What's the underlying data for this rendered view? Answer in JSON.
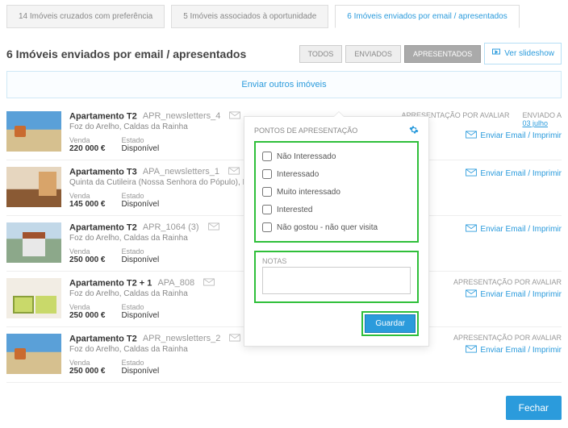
{
  "tabs": {
    "crossed": "14 Imóveis cruzados com preferência",
    "associated": "5 Imóveis associados à oportunidade",
    "sent": "6 Imóveis enviados por email / apresentados"
  },
  "page_title": "6 Imóveis enviados por email / apresentados",
  "filters": {
    "all": "TODOS",
    "sent": "ENVIADOS",
    "presented": "APRESENTADOS"
  },
  "slideshow_label": "Ver slideshow",
  "banner": "Enviar outros imóveis",
  "labels": {
    "presentation_eval": "APRESENTAÇÃO POR AVALIAR",
    "sent_at": "ENVIADO A",
    "type": "Venda",
    "estado": "Estado",
    "action": "Enviar Email / Imprimir"
  },
  "popover": {
    "title": "PONTOS DE APRESENTAÇÃO",
    "opts": {
      "nao_interessado": "Não Interessado",
      "interessado": "Interessado",
      "muito_interessado": "Muito interessado",
      "interested": "Interested",
      "nao_gostou": "Não gostou - não quer visita"
    },
    "notes_label": "NOTAS",
    "save": "Guardar"
  },
  "close": "Fechar",
  "items": [
    {
      "title": "Apartamento T2",
      "ref": "APR_newsletters_4",
      "loc": "Foz do Arelho, Caldas da Rainha",
      "price": "220 000 €",
      "status": "Disponível",
      "sent_date": "03 julho"
    },
    {
      "title": "Apartamento T3",
      "ref": "APA_newsletters_1",
      "loc": "Quinta da Cutileira (Nossa Senhora do Pópulo), Nossa ...",
      "price": "145 000 €",
      "status": "Disponível",
      "sent_date": ""
    },
    {
      "title": "Apartamento T2",
      "ref": "APR_1064 (3)",
      "loc": "Foz do Arelho, Caldas da Rainha",
      "price": "250 000 €",
      "status": "Disponível",
      "sent_date": ""
    },
    {
      "title": "Apartamento T2 + 1",
      "ref": "APA_808",
      "loc": "Foz do Arelho, Caldas da Rainha",
      "price": "250 000 €",
      "status": "Disponível",
      "sent_date": "",
      "right_label": "APRESENTAÇÃO POR AVALIAR"
    },
    {
      "title": "Apartamento T2",
      "ref": "APR_newsletters_2",
      "loc": "Foz do Arelho, Caldas da Rainha",
      "price": "250 000 €",
      "status": "Disponível",
      "sent_date": "",
      "right_label": "APRESENTAÇÃO POR AVALIAR"
    }
  ]
}
